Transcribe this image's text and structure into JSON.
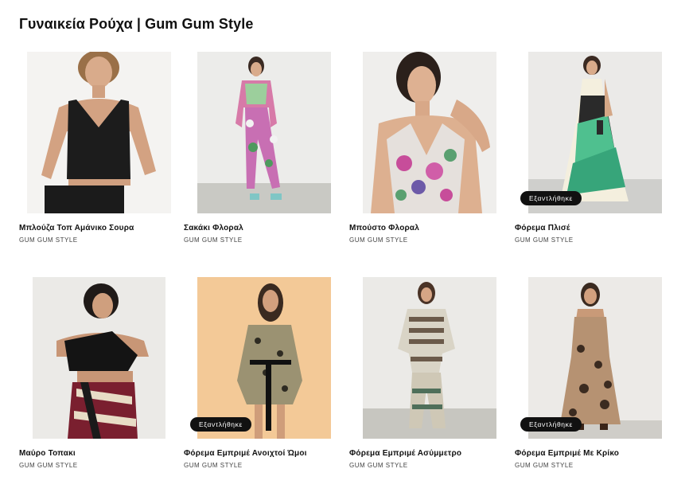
{
  "page": {
    "title": "Γυναικεία Ρούχα | Gum Gum Style"
  },
  "products": [
    {
      "name": "Μπλούζα Τοπ Αμάνικο Σουρα",
      "brand": "GUM GUM STYLE",
      "badge": ""
    },
    {
      "name": "Σακάκι Φλοραλ",
      "brand": "GUM GUM STYLE",
      "badge": ""
    },
    {
      "name": "Μπούστο Φλοραλ",
      "brand": "GUM GUM STYLE",
      "badge": ""
    },
    {
      "name": "Φόρεμα Πλισέ",
      "brand": "GUM GUM STYLE",
      "badge": "Εξαντλήθηκε"
    },
    {
      "name": "Μαύρο Τοπακι",
      "brand": "GUM GUM STYLE",
      "badge": ""
    },
    {
      "name": "Φόρεμα Εμπριμέ Ανοιχτοί Ώμοι",
      "brand": "GUM GUM STYLE",
      "badge": "Εξαντλήθηκε"
    },
    {
      "name": "Φόρεμα Εμπριμέ Ασύμμετρο",
      "brand": "GUM GUM STYLE",
      "badge": ""
    },
    {
      "name": "Φόρεμα Εμπριμέ Με Κρίκο",
      "brand": "GUM GUM STYLE",
      "badge": "Εξαντλήθηκε"
    }
  ]
}
